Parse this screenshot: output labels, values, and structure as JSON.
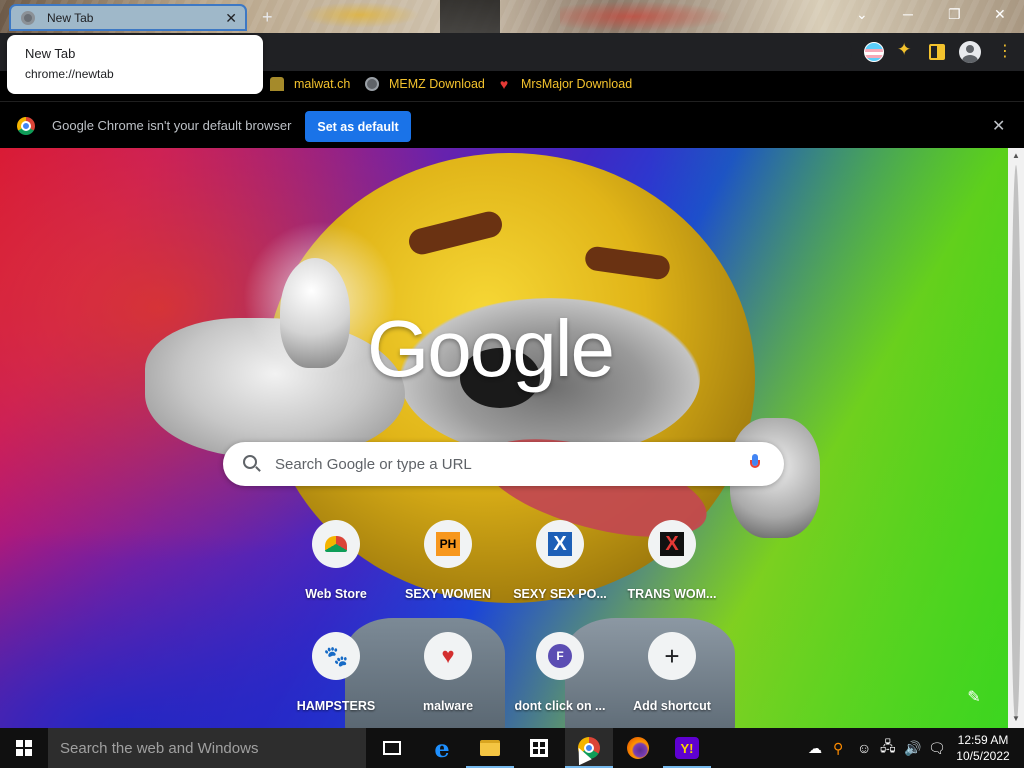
{
  "window": {
    "tab_title": "New Tab",
    "tab_close": "✕",
    "new_tab": "+",
    "minimize": "─",
    "restore": "❐",
    "close": "✕",
    "chevron": "⌄"
  },
  "hovercard": {
    "title": "New Tab",
    "url": "chrome://newtab"
  },
  "toolbar": {
    "icons": [
      "flag-icon",
      "puzzle-icon",
      "sidepanel-icon",
      "profile-icon",
      "menu-icon"
    ],
    "puzzle_glyph": "✦",
    "menu_glyph": "⋮"
  },
  "bookmarks": [
    {
      "label": "malwat.ch",
      "icon": "malwatch-icon"
    },
    {
      "label": "MEMZ Download",
      "icon": "globe-icon"
    },
    {
      "label": "MrsMajor Download",
      "icon": "heart-icon",
      "glyph": "♥"
    }
  ],
  "infobar": {
    "message": "Google Chrome isn't your default browser",
    "button": "Set as default",
    "close": "✕"
  },
  "newtab": {
    "logo": "Google",
    "search_placeholder": "Search Google or type a URL",
    "edit_glyph": "✎",
    "shortcuts": [
      {
        "label": "Web Store",
        "icon": "webstore-icon"
      },
      {
        "label": "SEXY WOMEN",
        "icon": "ph-icon",
        "glyph": "PH"
      },
      {
        "label": "SEXY SEX PO...",
        "icon": "x-icon",
        "glyph": "X"
      },
      {
        "label": "TRANS WOM...",
        "icon": "red-x-icon",
        "glyph": "X"
      },
      {
        "label": "HAMPSTERS",
        "icon": "hamster-icon",
        "glyph": "🐾"
      },
      {
        "label": "malware",
        "icon": "heart-icon",
        "glyph": "♥"
      },
      {
        "label": "dont click on ...",
        "icon": "f-icon",
        "glyph": "F"
      },
      {
        "label": "Add shortcut",
        "icon": "plus-icon",
        "glyph": "+"
      }
    ]
  },
  "scrollbar": {
    "up": "▲",
    "down": "▼"
  },
  "taskbar": {
    "search_placeholder": "Search the web and Windows",
    "apps": [
      "task-view-icon",
      "edge-icon",
      "file-explorer-icon",
      "store-icon",
      "chrome-icon",
      "firefox-icon",
      "yahoo-icon"
    ],
    "edge_glyph": "e",
    "yahoo_glyph": "Y!",
    "tray": [
      "cloud-icon",
      "search-app-icon",
      "emoji-icon",
      "network-icon",
      "volume-icon",
      "notification-icon"
    ],
    "tray_glyphs": [
      "☁",
      "⚲",
      "☺",
      "🖧",
      "🔊",
      "🗨"
    ],
    "time": "12:59 AM",
    "date": "10/5/2022"
  }
}
